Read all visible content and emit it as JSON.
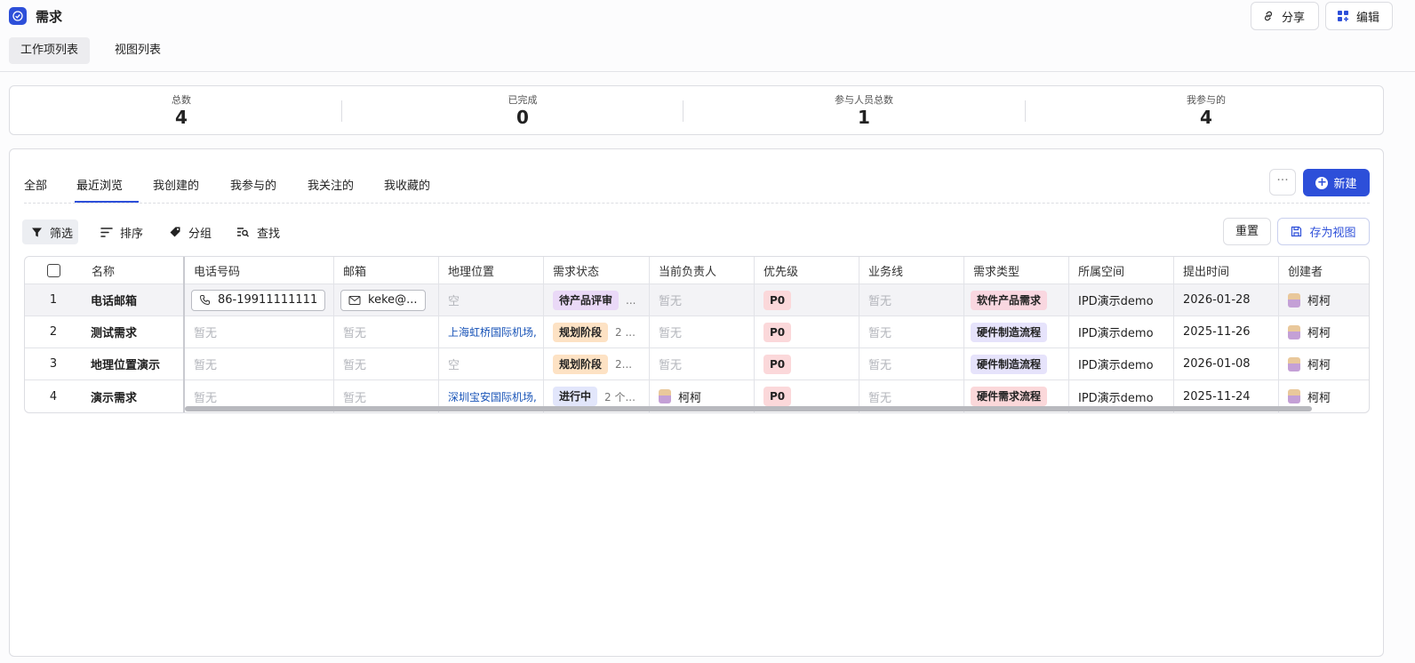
{
  "app": {
    "title": "需求",
    "icon": "circle-check-icon"
  },
  "top_buttons": {
    "share": "分享",
    "edit": "编辑"
  },
  "view_tabs": [
    {
      "label": "工作项列表",
      "active": true
    },
    {
      "label": "视图列表",
      "active": false
    }
  ],
  "stats": [
    {
      "label": "总数",
      "value": "4"
    },
    {
      "label": "已完成",
      "value": "0"
    },
    {
      "label": "参与人员总数",
      "value": "1"
    },
    {
      "label": "我参与的",
      "value": "4"
    }
  ],
  "filter_tabs": [
    {
      "label": "全部",
      "active": false
    },
    {
      "label": "最近浏览",
      "active": true
    },
    {
      "label": "我创建的",
      "active": false
    },
    {
      "label": "我参与的",
      "active": false
    },
    {
      "label": "我关注的",
      "active": false
    },
    {
      "label": "我收藏的",
      "active": false
    }
  ],
  "actions": {
    "more": "···",
    "new": "新建",
    "reset": "重置",
    "save_view": "存为视图"
  },
  "toolbar": {
    "filter": "筛选",
    "sort": "排序",
    "group": "分组",
    "find": "查找"
  },
  "table": {
    "columns": [
      "名称",
      "电话号码",
      "邮箱",
      "地理位置",
      "需求状态",
      "当前负责人",
      "优先级",
      "业务线",
      "需求类型",
      "所属空间",
      "提出时间",
      "创建者"
    ],
    "rows": [
      {
        "index": "1",
        "name": "电话邮箱",
        "phone": "86-19911111111",
        "email": "keke@...",
        "location": "空",
        "status": "待产品评审",
        "status_extra": "...",
        "owner": "暂无",
        "priority": "P0",
        "business": "暂无",
        "type": "软件产品需求",
        "space": "IPD演示demo",
        "date": "2026-01-28",
        "creator": "柯柯"
      },
      {
        "index": "2",
        "name": "测试需求",
        "phone": "暂无",
        "email": "暂无",
        "location": "上海虹桥国际机场,",
        "status": "规划阶段",
        "status_extra": "2 ...",
        "owner": "暂无",
        "priority": "P0",
        "business": "暂无",
        "type": "硬件制造流程",
        "space": "IPD演示demo",
        "date": "2025-11-26",
        "creator": "柯柯"
      },
      {
        "index": "3",
        "name": "地理位置演示",
        "phone": "暂无",
        "email": "暂无",
        "location": "空",
        "status": "规划阶段",
        "status_extra": "2...",
        "owner": "暂无",
        "priority": "P0",
        "business": "暂无",
        "type": "硬件制造流程",
        "space": "IPD演示demo",
        "date": "2026-01-08",
        "creator": "柯柯"
      },
      {
        "index": "4",
        "name": "演示需求",
        "phone": "暂无",
        "email": "暂无",
        "location": "深圳宝安国际机场,",
        "status": "进行中",
        "status_extra": "2 个...",
        "owner": "柯柯",
        "priority": "P0",
        "business": "暂无",
        "type": "硬件需求流程",
        "space": "IPD演示demo",
        "date": "2025-11-24",
        "creator": "柯柯"
      }
    ]
  },
  "colors": {
    "accent": "#2d4fd9",
    "priority_bg": "#fbd8da",
    "status_pending": "#ead9f7",
    "status_planning": "#fde2c4",
    "status_progress": "#e2e6fb"
  }
}
